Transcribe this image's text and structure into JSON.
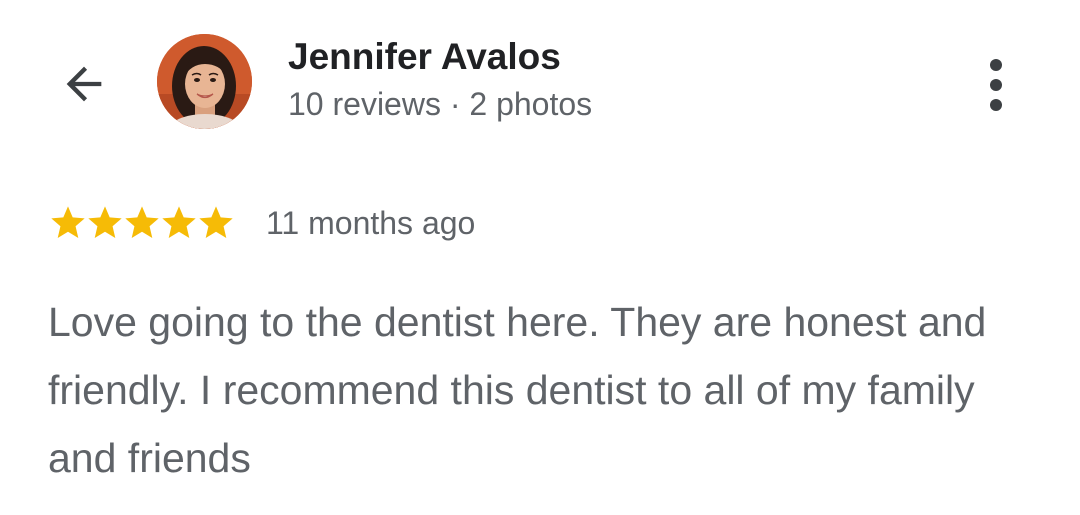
{
  "header": {
    "back_icon": "arrow-back-icon",
    "more_icon": "more-vert-icon"
  },
  "reviewer": {
    "name": "Jennifer Avalos",
    "stats": "10 reviews · 2 photos",
    "avatar_icon": "profile-photo"
  },
  "review": {
    "rating": 5,
    "rating_max": 5,
    "star_color": "#f6bb06",
    "time": "11 months ago",
    "text": "Love going to the dentist here. They are honest and friendly. I recommend this dentist to all of my family and friends"
  },
  "colors": {
    "primary_text": "#202124",
    "secondary_text": "#5f6368"
  }
}
